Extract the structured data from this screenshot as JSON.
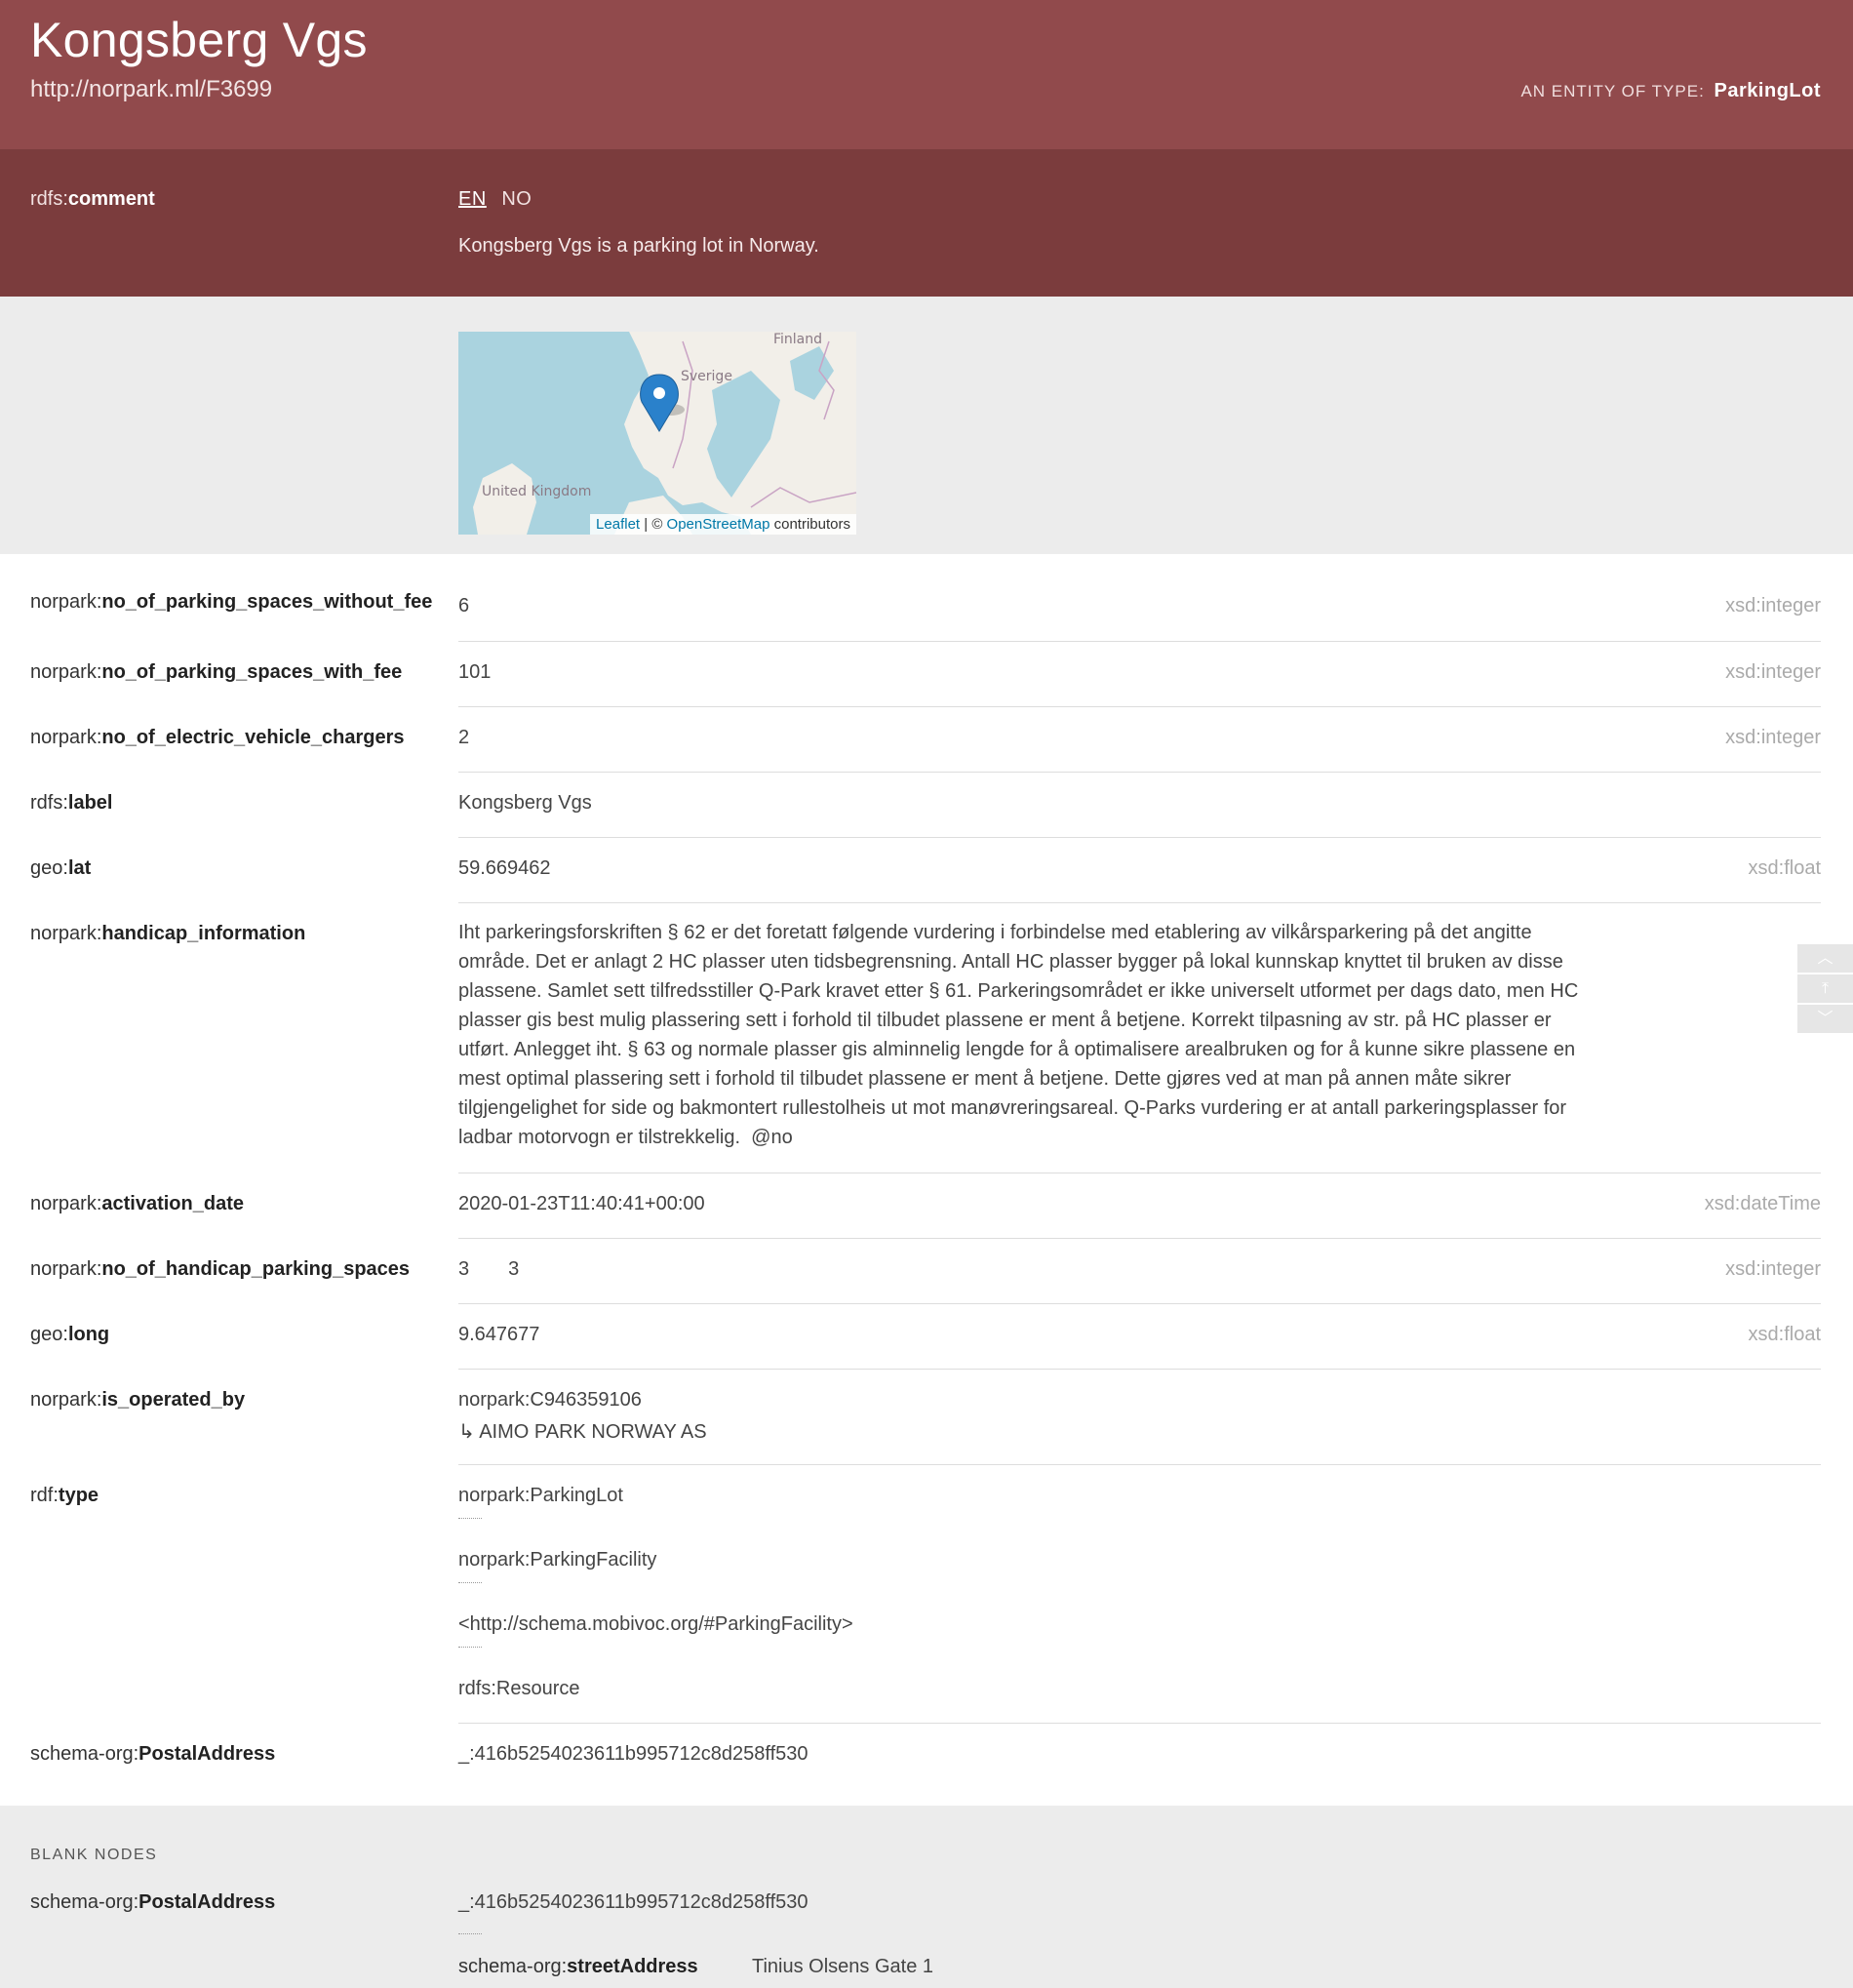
{
  "header": {
    "title": "Kongsberg Vgs",
    "uri": "http://norpark.ml/F3699",
    "entity_type_label": "AN ENTITY OF TYPE:",
    "entity_type_value": "ParkingLot"
  },
  "comment": {
    "prefix": "rdfs:",
    "name": "comment",
    "lang_tabs": [
      "EN",
      "NO"
    ],
    "active_lang": "EN",
    "value": "Kongsberg Vgs is a parking lot in Norway."
  },
  "map": {
    "labels": [
      "Finland",
      "Sverige",
      "United Kingdom"
    ],
    "attribution": {
      "leaflet": "Leaflet",
      "sep": " | © ",
      "osm": "OpenStreetMap",
      "suffix": " contributors"
    },
    "marker_icon": "map-marker-icon"
  },
  "properties": [
    {
      "prefix": "norpark:",
      "name": "no_of_parking_spaces_without_fee",
      "value": "6",
      "dtype": "xsd:integer"
    },
    {
      "prefix": "norpark:",
      "name": "no_of_parking_spaces_with_fee",
      "value": "101",
      "dtype": "xsd:integer"
    },
    {
      "prefix": "norpark:",
      "name": "no_of_electric_vehicle_chargers",
      "value": "2",
      "dtype": "xsd:integer"
    },
    {
      "prefix": "rdfs:",
      "name": "label",
      "value": "Kongsberg Vgs",
      "dtype": ""
    },
    {
      "prefix": "geo:",
      "name": "lat",
      "value": "59.669462",
      "dtype": "xsd:float"
    },
    {
      "prefix": "norpark:",
      "name": "handicap_information",
      "value": "Iht parkeringsforskriften § 62 er det foretatt følgende vurdering i forbindelse med etablering av vilkårsparkering på det angitte område. Det er anlagt 2 HC plasser uten tidsbegrensning. Antall HC plasser bygger på lokal kunnskap knyttet til bruken av disse plassene. Samlet sett tilfredsstiller Q-Park kravet etter § 61. Parkeringsområdet er ikke universelt utformet per dags dato, men HC plasser gis best mulig plassering sett i forhold til tilbudet plassene er ment å betjene. Korrekt tilpasning av str. på HC plasser er utført. Anlegget iht. § 63 og normale plasser gis alminnelig lengde for å optimalisere arealbruken og for å kunne sikre plassene en mest optimal plassering sett i forhold til tilbudet plassene er ment å betjene. Dette gjøres ved at man på annen måte sikrer tilgjengelighet for side og bakmontert rullestolheis ut mot manøvreringsareal. Q-Parks vurdering er at antall parkeringsplasser for ladbar motorvogn er tilstrekkelig.",
      "lang": "@no",
      "dtype": ""
    },
    {
      "prefix": "norpark:",
      "name": "activation_date",
      "value": "2020-01-23T11:40:41+00:00",
      "dtype": "xsd:dateTime"
    },
    {
      "prefix": "norpark:",
      "name": "no_of_handicap_parking_spaces",
      "value": "3",
      "value2": "3",
      "dtype": "xsd:integer"
    },
    {
      "prefix": "geo:",
      "name": "long",
      "value": "9.647677",
      "dtype": "xsd:float"
    },
    {
      "prefix": "norpark:",
      "name": "is_operated_by",
      "value": "norpark:C946359106",
      "sub": "↳ AIMO PARK NORWAY AS",
      "dtype": ""
    },
    {
      "prefix": "rdf:",
      "name": "type",
      "values": [
        "norpark:ParkingLot",
        "norpark:ParkingFacility",
        "<http://schema.mobivoc.org/#ParkingFacility>",
        "rdfs:Resource"
      ],
      "dtype": ""
    },
    {
      "prefix": "schema-org:",
      "name": "PostalAddress",
      "value": "_:416b5254023611b995712c8d258ff530",
      "dtype": ""
    }
  ],
  "blank_nodes": {
    "heading": "BLANK NODES",
    "prefix": "schema-org:",
    "name": "PostalAddress",
    "value": "_:416b5254023611b995712c8d258ff530",
    "sub_prefix": "schema-org:",
    "sub_name": "streetAddress",
    "sub_value": "Tinius Olsens Gate 1"
  },
  "scroll_nav": [
    "scroll-up-icon",
    "scroll-top-icon",
    "scroll-down-icon"
  ]
}
